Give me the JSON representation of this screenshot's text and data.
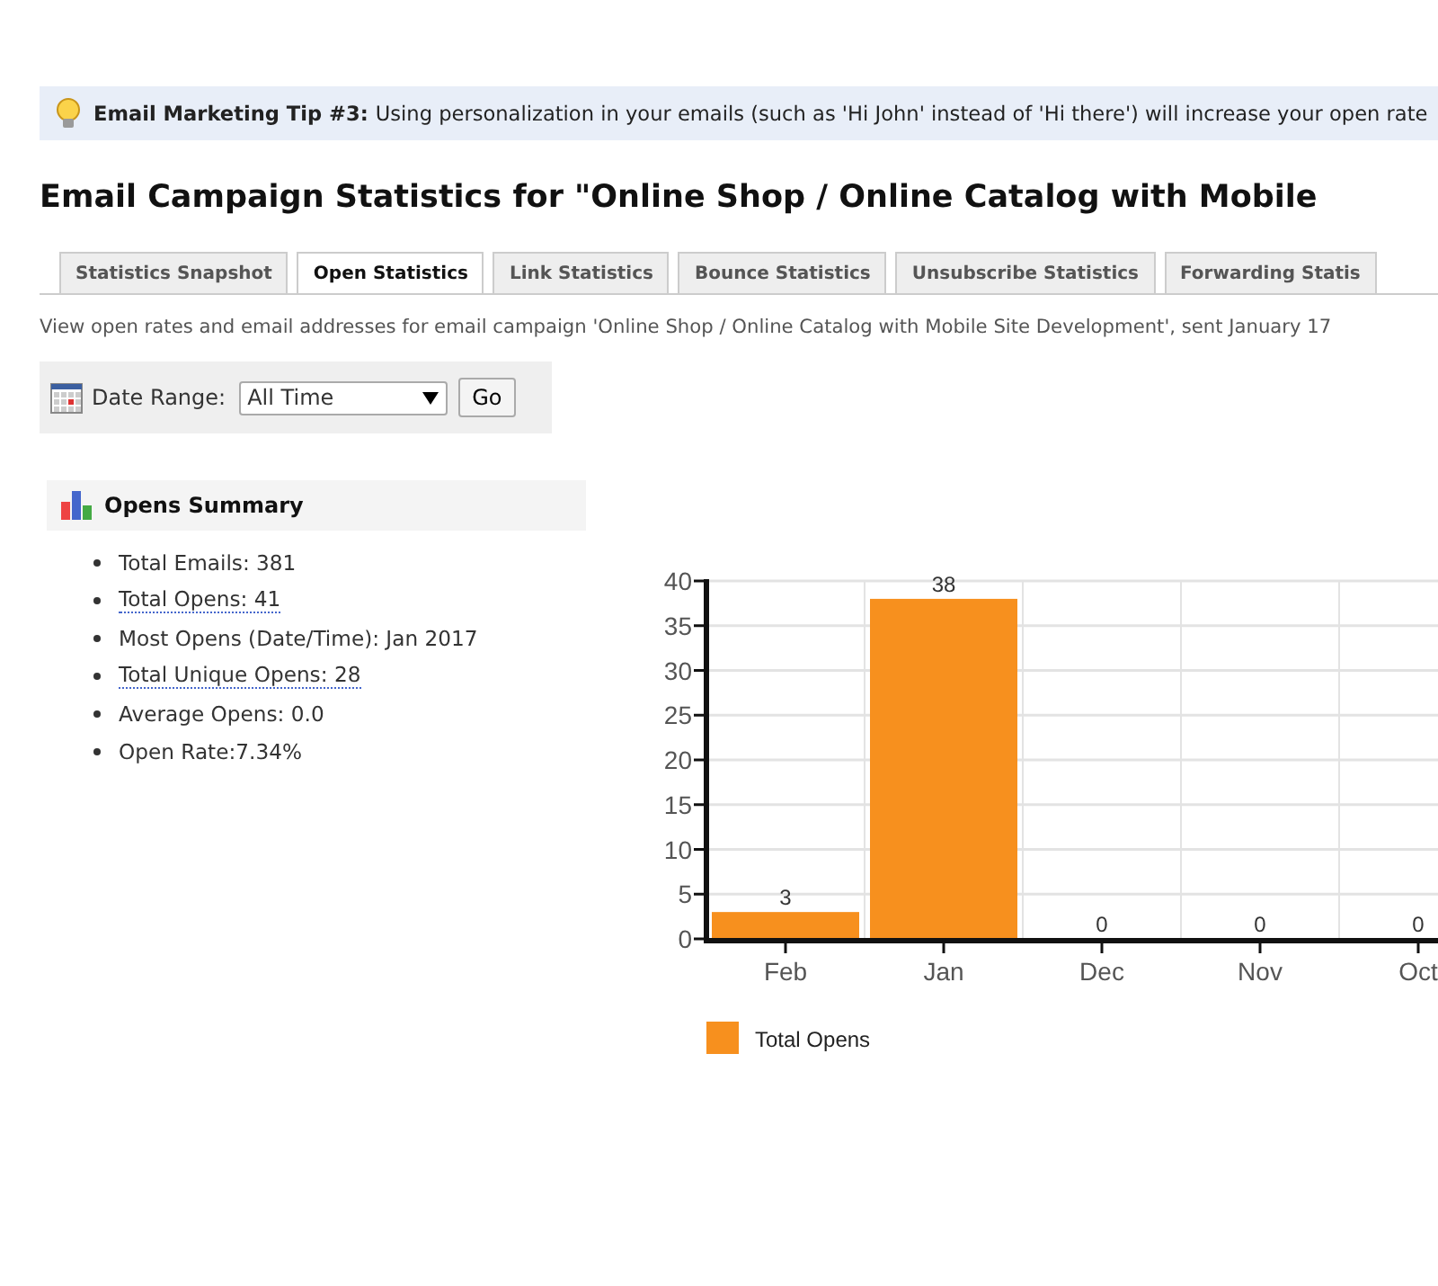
{
  "tip": {
    "label": "Email Marketing Tip #3:",
    "text": "Using personalization in your emails (such as 'Hi John' instead of 'Hi there') will increase your open rate"
  },
  "title": "Email Campaign Statistics for \"Online Shop / Online Catalog with Mobile",
  "tabs": [
    {
      "label": "Statistics Snapshot",
      "selected": false
    },
    {
      "label": "Open Statistics",
      "selected": true
    },
    {
      "label": "Link Statistics",
      "selected": false
    },
    {
      "label": "Bounce Statistics",
      "selected": false
    },
    {
      "label": "Unsubscribe Statistics",
      "selected": false
    },
    {
      "label": "Forwarding Statis",
      "selected": false
    }
  ],
  "description": "View open rates and email addresses for email campaign 'Online Shop / Online Catalog with Mobile Site Development', sent January 17",
  "date_range": {
    "label": "Date Range:",
    "value": "All Time",
    "button": "Go"
  },
  "summary": {
    "title": "Opens Summary",
    "items": [
      {
        "text": "Total Emails: 381",
        "kind": "plain"
      },
      {
        "text": "Total Opens: 41",
        "kind": "link"
      },
      {
        "text": "Most Opens (Date/Time): Jan 2017",
        "kind": "plain"
      },
      {
        "text": "Total Unique Opens: 28",
        "kind": "link"
      },
      {
        "text": "Average Opens: 0.0",
        "kind": "plain"
      },
      {
        "text": "Open Rate:7.34%",
        "kind": "plain"
      }
    ]
  },
  "chart": {
    "chart_data": {
      "type": "bar",
      "categories": [
        "Feb",
        "Jan",
        "Dec",
        "Nov",
        "Oct"
      ],
      "series": [
        {
          "name": "Total Opens",
          "color": "#f7901e",
          "values": [
            3,
            38,
            0,
            0,
            0
          ]
        }
      ],
      "ylim": [
        0,
        40
      ],
      "grid": true,
      "yticks": [
        0,
        5,
        10,
        15,
        20,
        25,
        30,
        35,
        40
      ],
      "data_labels": true
    }
  }
}
